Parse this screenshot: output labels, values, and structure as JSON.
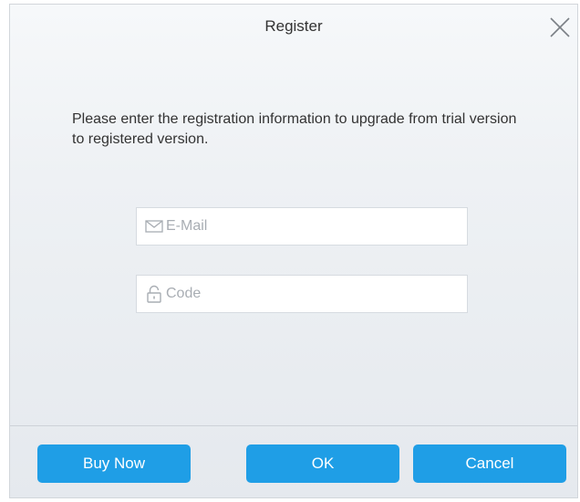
{
  "dialog": {
    "title": "Register",
    "message": "Please enter the registration information to upgrade from trial version to registered version."
  },
  "fields": {
    "email": {
      "placeholder": "E-Mail",
      "value": "",
      "icon": "envelope-icon"
    },
    "code": {
      "placeholder": "Code",
      "value": "",
      "icon": "lock-icon"
    }
  },
  "buttons": {
    "buy_now": "Buy Now",
    "ok": "OK",
    "cancel": "Cancel"
  },
  "colors": {
    "accent": "#1f9ee6",
    "icon_gray": "#a8adb3"
  }
}
